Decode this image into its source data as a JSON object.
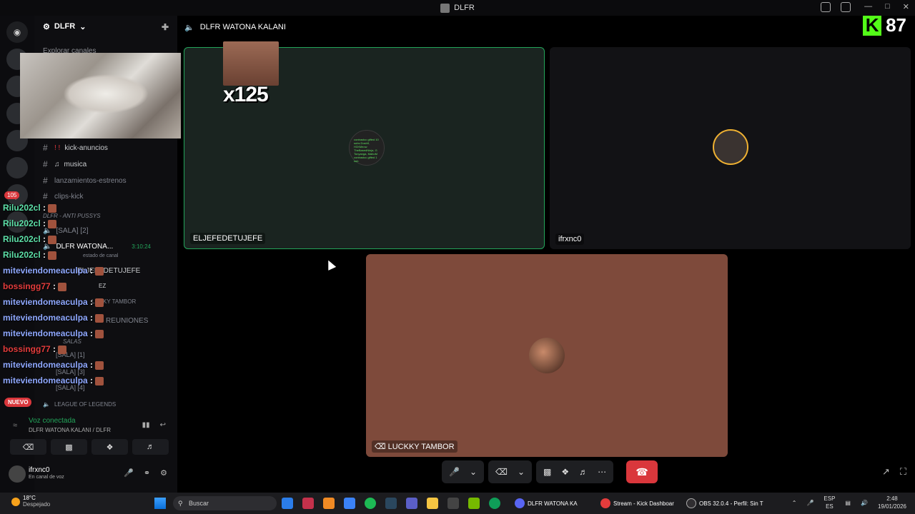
{
  "window": {
    "title": "DLFR"
  },
  "kick_overlay": {
    "count": "87"
  },
  "server": {
    "name": "DLFR",
    "explore": "Explorar canales"
  },
  "channels": [
    {
      "name": "kick-anuncios",
      "prefix": "! !"
    },
    {
      "name": "musica"
    },
    {
      "name": "lanzamientos-estrenos"
    },
    {
      "name": "clips-kick"
    },
    {
      "name": "DLFR - ANTI PUSSYS"
    },
    {
      "name": "[SALA] [2]"
    },
    {
      "name": "DLFR WATONA...",
      "time": "3:10:24",
      "status": "estado de canal"
    },
    {
      "name": "ELJEFEDETUJEFE"
    },
    {
      "name": "EZ"
    },
    {
      "name": "LUCKY TAMBOR"
    },
    {
      "name": "REUNIONES"
    },
    {
      "name": "SALAS"
    },
    {
      "name": "[SALA] [1]"
    },
    {
      "name": "[SALA] [3]"
    },
    {
      "name": "[SALA] [4]"
    },
    {
      "name": "LEAGUE OF LEGENDS"
    }
  ],
  "chat": [
    {
      "user": "Rilu202cl",
      "style": "u1"
    },
    {
      "user": "Rilu202cl",
      "style": "u1"
    },
    {
      "user": "Rilu202cl",
      "style": "u1"
    },
    {
      "user": "Rilu202cl",
      "style": "u1"
    },
    {
      "user": "miteviendomeaculpa",
      "style": "u2"
    },
    {
      "user": "bossingg77",
      "style": "u3"
    },
    {
      "user": "miteviendomeaculpa",
      "style": "u2"
    },
    {
      "user": "miteviendomeaculpa",
      "style": "u2"
    },
    {
      "user": "miteviendomeaculpa",
      "style": "u2"
    },
    {
      "user": "bossingg77",
      "style": "u3"
    },
    {
      "user": "miteviendomeaculpa",
      "style": "u2"
    },
    {
      "user": "miteviendomeaculpa",
      "style": "u2"
    }
  ],
  "rail_badges": {
    "b1": "105",
    "b2": "NUEVO"
  },
  "voice": {
    "status": "Voz conectada",
    "channel": "DLFR WATONA KALANI / DLFR"
  },
  "user": {
    "name": "ifrxnc0",
    "status": "En canal de voz"
  },
  "stage": {
    "channel": "DLFR WATONA KALANI",
    "gift_count": "x125",
    "tiles": [
      {
        "name": "ELJEFEDETUJEFE"
      },
      {
        "name": "ifrxnc0"
      },
      {
        "name": "LUCKKY TAMBOR"
      }
    ],
    "mini_chat": "contrastcc gifted 10 subs Dosh9, H3XMeow TheBasedNinja, G Tonyanga, MahoM contrastcc gifted 1 sub"
  },
  "taskbar": {
    "weather_temp": "18°C",
    "weather_desc": "Despejado",
    "search": "Buscar",
    "task1": "DLFR WATONA KA",
    "task2": "Stream - Kick Dashboar",
    "task3": "OBS 32.0.4 - Perfil: Sin T",
    "lang1": "ESP",
    "lang2": "ES",
    "time": "2:48",
    "date": "19/01/2026"
  },
  "colors": {
    "accent": "#23a55a",
    "danger": "#da373c",
    "kick": "#53fc18"
  }
}
